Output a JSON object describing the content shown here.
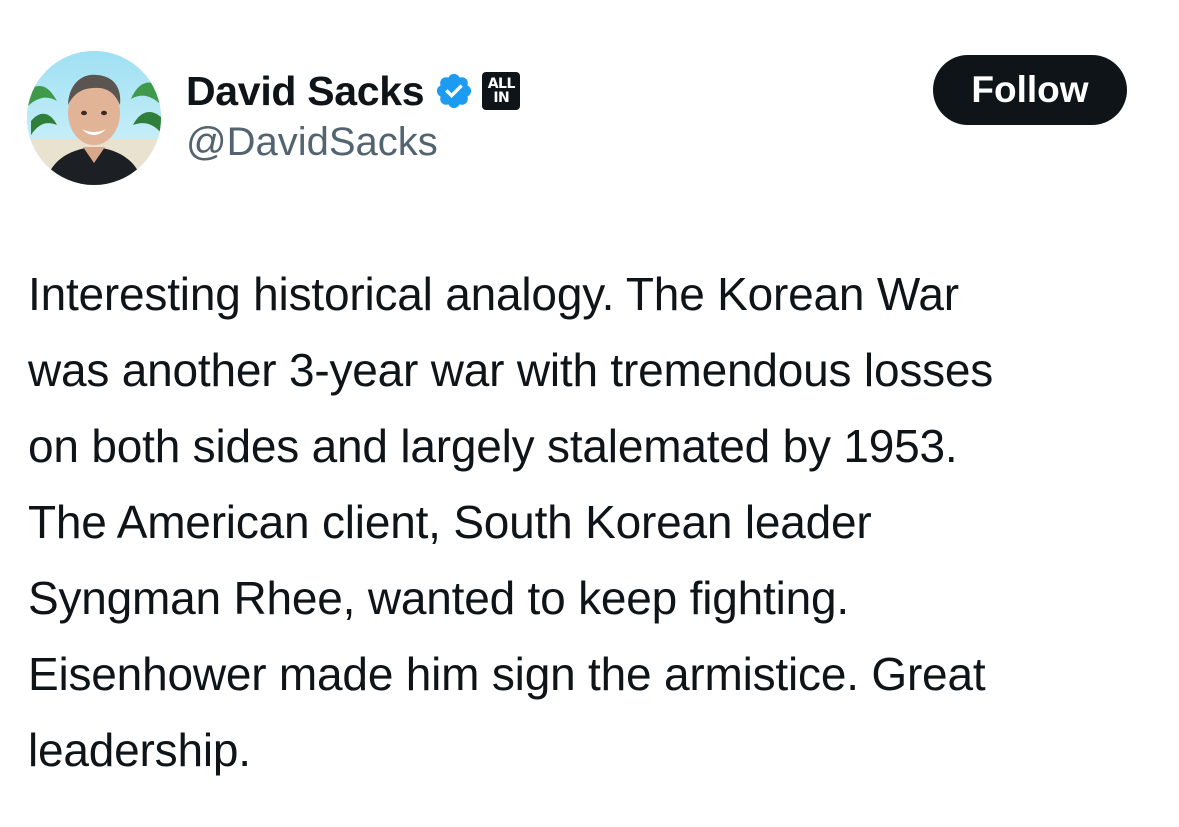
{
  "author": {
    "display_name": "David Sacks",
    "handle": "@DavidSacks",
    "avatar_icon": "profile-photo",
    "verified_icon": "verified-badge-icon",
    "verified_color": "#1d9bf0",
    "affiliate_badge": {
      "line1": "ALL",
      "line2": "IN"
    }
  },
  "actions": {
    "follow_label": "Follow"
  },
  "tweet": {
    "lines": [
      "Interesting historical analogy. The Korean War",
      "was another 3-year war with tremendous losses",
      "on both sides and largely stalemated by 1953.",
      "The American client, South Korean leader",
      "Syngman Rhee, wanted to keep fighting.",
      "Eisenhower made him sign the armistice. Great",
      "leadership."
    ]
  },
  "colors": {
    "text_primary": "#0f1419",
    "text_secondary": "#536471",
    "button_bg": "#0f1419",
    "button_text": "#ffffff",
    "background": "#ffffff"
  }
}
